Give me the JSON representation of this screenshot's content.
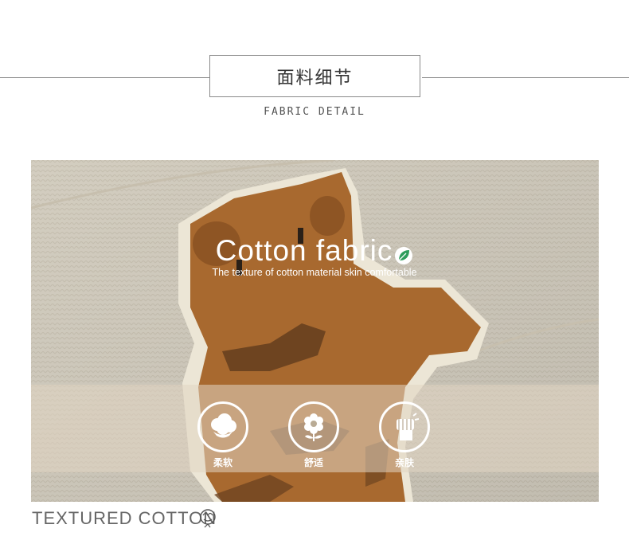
{
  "header": {
    "title_cn": "面料细节",
    "subtitle_en": "FABRIC DETAIL"
  },
  "hero": {
    "headline": "Cotton fabric",
    "tagline": "The texture of cotton material skin comfortable",
    "leaf_icon": "leaf-icon"
  },
  "features": [
    {
      "icon": "cotton-boll-icon",
      "label": "柔软"
    },
    {
      "icon": "flower-icon",
      "label": "舒适"
    },
    {
      "icon": "fist-icon",
      "label": "亲肤"
    }
  ],
  "footer": {
    "caption": "TEXTURED COTTON",
    "icon": "cotton-flower-icon"
  },
  "colors": {
    "fabric": "#d9d3c5",
    "bear": "#a8692f",
    "leaf": "#2e9d5c"
  }
}
